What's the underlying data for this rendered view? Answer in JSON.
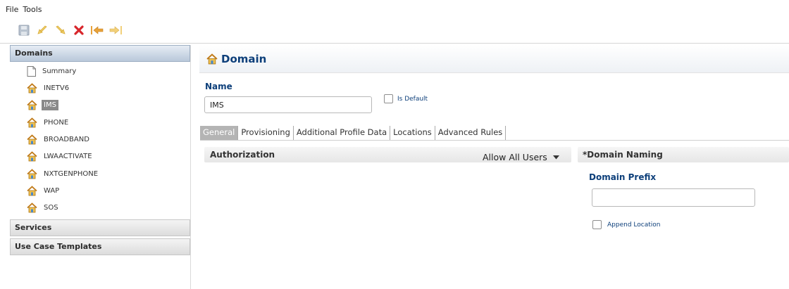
{
  "menu": [
    "File",
    "Tools"
  ],
  "toolbar": {
    "icons": [
      "save-icon",
      "undo-icon",
      "redo-icon",
      "delete-icon",
      "back-icon",
      "forward-icon"
    ],
    "colors": {
      "save": "#b9c3cf",
      "undo": "#f0cf6a",
      "redo": "#f0cf6a",
      "delete": "#d8262b",
      "back": "#e8a23a",
      "forward": "#f2d07a"
    }
  },
  "sidebar": {
    "sections": [
      {
        "label": "Domains",
        "active": true
      },
      {
        "label": "Services",
        "active": false
      },
      {
        "label": "Use Case Templates",
        "active": false
      }
    ],
    "items": [
      {
        "label": "Summary",
        "icon": "document-icon",
        "selected": false
      },
      {
        "label": "INETV6",
        "icon": "house-icon",
        "selected": false
      },
      {
        "label": "IMS",
        "icon": "house-icon",
        "selected": true
      },
      {
        "label": "PHONE",
        "icon": "house-icon",
        "selected": false
      },
      {
        "label": "BROADBAND",
        "icon": "house-icon",
        "selected": false
      },
      {
        "label": "LWAACTIVATE",
        "icon": "house-icon",
        "selected": false
      },
      {
        "label": "NXTGENPHONE",
        "icon": "house-icon",
        "selected": false
      },
      {
        "label": "WAP",
        "icon": "house-icon",
        "selected": false
      },
      {
        "label": "SOS",
        "icon": "house-icon",
        "selected": false
      }
    ]
  },
  "main": {
    "title": "Domain",
    "name_label": "Name",
    "name_value": "IMS",
    "is_default_label": "Is Default",
    "tabs": [
      {
        "label": "General",
        "active": true
      },
      {
        "label": "Provisioning",
        "active": false
      },
      {
        "label": "Additional Profile Data",
        "active": false
      },
      {
        "label": "Locations",
        "active": false
      },
      {
        "label": "Advanced Rules",
        "active": false
      }
    ],
    "authorization": {
      "title": "Authorization",
      "selected": "Allow All Users"
    },
    "naming": {
      "title": "*Domain Naming",
      "prefix_label": "Domain Prefix",
      "prefix_value": "",
      "append_location_label": "Append Location"
    }
  },
  "colors": {
    "title_blue": "#0d3f7a",
    "active_header": "#b9c8da",
    "selected_item": "#8a8a8a",
    "active_tab": "#b4b4b4"
  }
}
